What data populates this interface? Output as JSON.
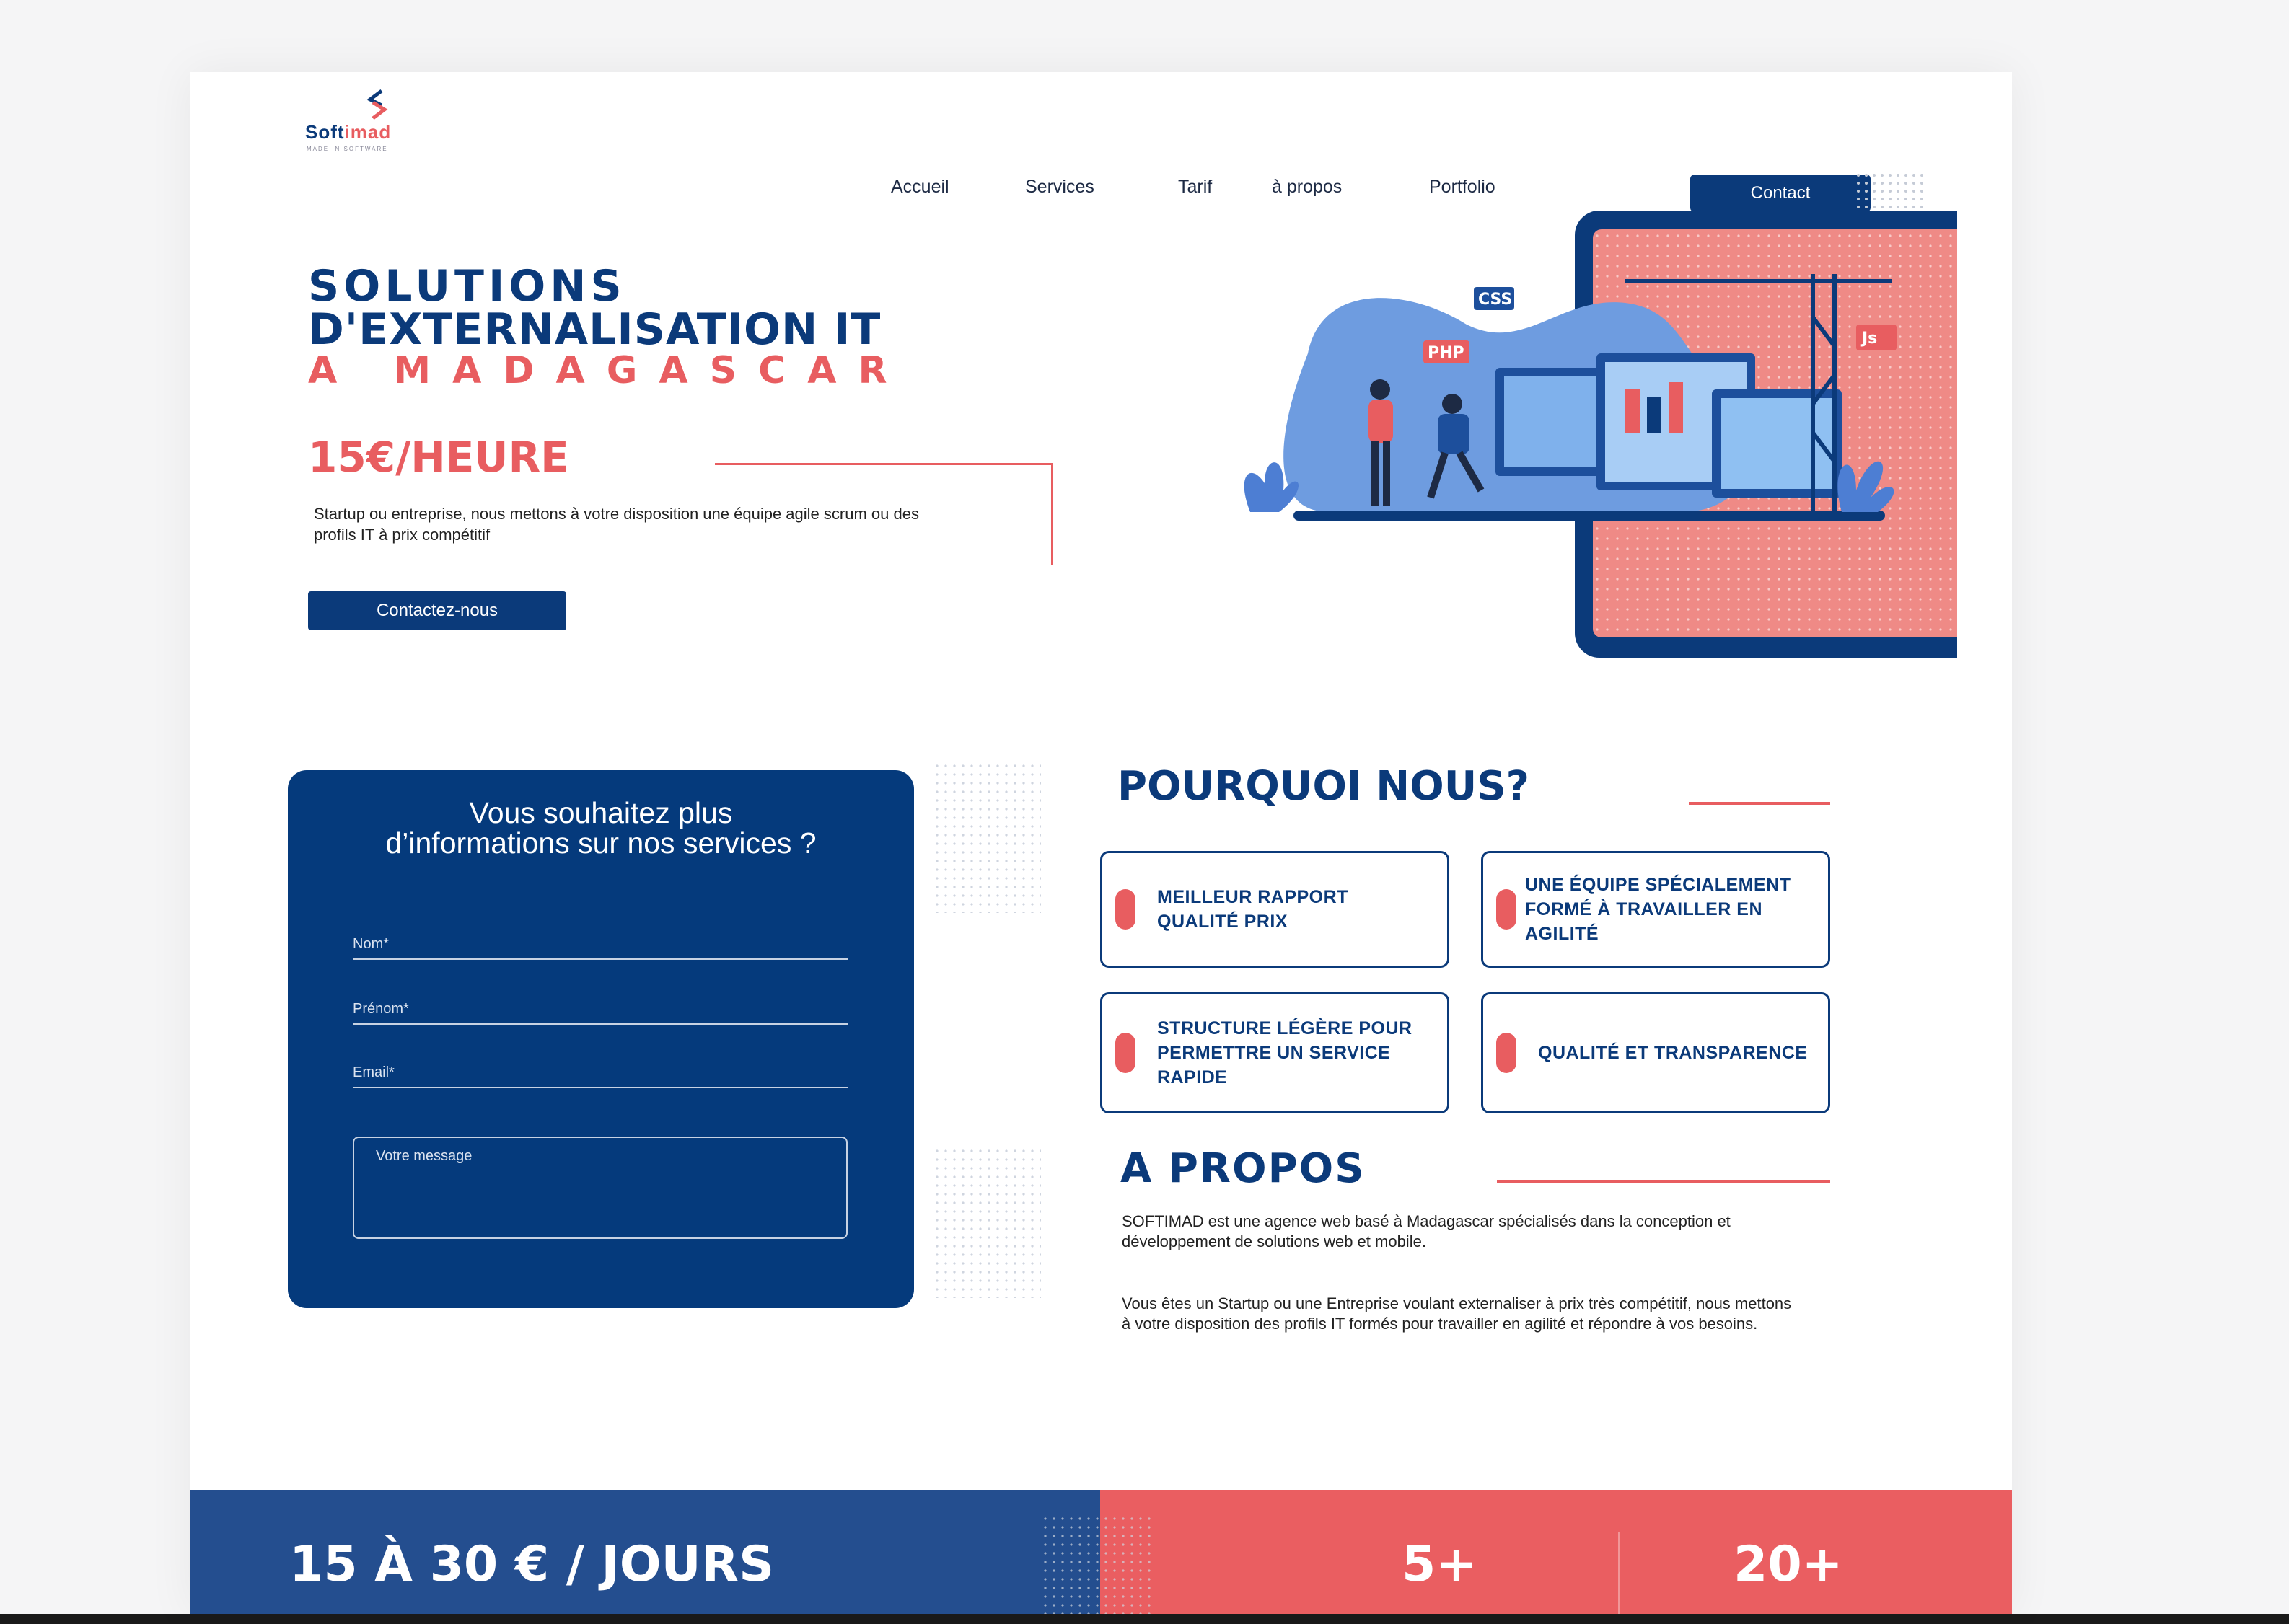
{
  "brand": {
    "name_part1": "Soft",
    "name_part2": "imad",
    "tagline": "MADE IN SOFTWARE"
  },
  "nav": {
    "items": [
      "Accueil",
      "Services",
      "Tarif",
      "à propos",
      "Portfolio"
    ],
    "contact": "Contact"
  },
  "hero": {
    "line1": "SOLUTIONS",
    "line2": "D'EXTERNALISATION IT",
    "line3": "A MADAGASCAR",
    "price": "15€/HEURE",
    "description": "Startup ou entreprise, nous mettons à votre disposition une équipe agile scrum ou des profils IT à prix compétitif",
    "cta": "Contactez-nous",
    "illustration_labels": [
      "CSS",
      "PHP",
      "Js"
    ]
  },
  "form": {
    "title": "Vous souhaitez plus d’informations sur nos services ?",
    "nom": "Nom*",
    "prenom": "Prénom*",
    "email": "Email*",
    "message": "Votre message"
  },
  "why": {
    "title": "POURQUOI NOUS?",
    "cards": [
      "Meilleur rapport qualité prix",
      "Une équipe spécialement formé à travailler en agilité",
      "Structure légère pour permettre un service rapide",
      "Qualité et transparence"
    ]
  },
  "about": {
    "title": "A PROPOS",
    "p1": "SOFTIMAD est une agence web basé à Madagascar spécialisés dans la conception et développement de solutions web et mobile.",
    "p2": "Vous êtes un Startup ou une Entreprise voulant externaliser à prix très compétitif, nous mettons à votre disposition des profils IT formés pour travailler en agilité et répondre à vos besoins."
  },
  "stats": {
    "left": "15 À 30 € / JOURS",
    "mid": "5+",
    "right": "20+"
  },
  "colors": {
    "navy": "#0b3a7a",
    "coral": "#e85d60",
    "stat_blue": "#244e8f"
  }
}
